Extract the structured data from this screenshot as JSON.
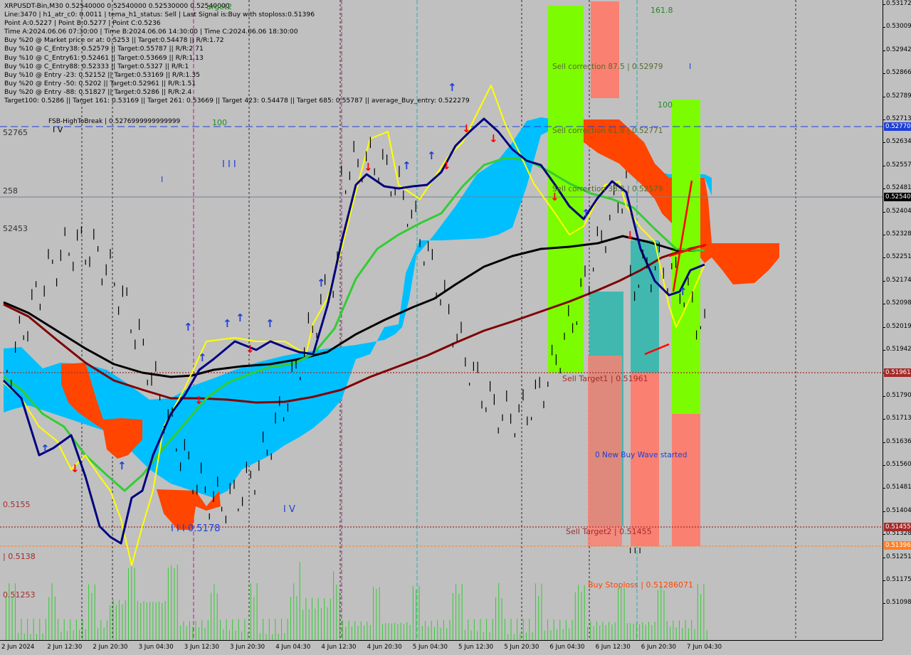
{
  "window": {
    "symbol_line": "XRPUSDT-Bin,M30  0.52540000 0.52540000 0.52530000 0.52540000"
  },
  "info_lines": [
    "Line:3470 | h1_atr_c0: 0.0011 | tema_h1_status: Sell | Last Signal is:Buy with stoploss:0.51396",
    "Point A:0.5227 | Point B:0.5277 | Point C:0.5236",
    "Time A:2024.06.06 07:30:00 | Time B:2024.06.06 14:30:00 | Time C:2024.06.06 18:30:00",
    "Buy %20 @ Market price or at: 0.5253 || Target:0.54478 || R/R:1.72",
    "Buy %10 @ C_Entry38: 0.52579 || Target:0.55787 || R/R:2.71",
    "Buy %10 @ C_Entry61: 0.52461 || Target:0.53669 || R/R:1.13",
    "Buy %10 @ C_Entry88: 0.52333 || Target:0.5327 || R/R:1",
    "Buy %10 @ Entry -23: 0.52152 || Target:0.53169 || R/R:1.35",
    "Buy %20 @ Entry -50: 0.5202 || Target:0.52961 || R/R:1.51",
    "Buy %20 @ Entry -88: 0.51827 || Target:0.5286 || R/R:2.4",
    "Target100: 0.5286 || Target 161: 0.53169 || Target 261: 0.53669 || Target 423: 0.54478 || Target 685: 0.55787 || average_Buy_entry: 0.522279"
  ],
  "chart_labels": {
    "target2": "arget2",
    "fsb": "FSB-HighToBreak | 0.5276999999999999",
    "fsb_100": "100",
    "level_52765": "52765",
    "level_258": "258",
    "level_52453": "52453",
    "level_5155": "0.5155",
    "level_5138": "| 0.5138",
    "level_51253": "0.51253",
    "iv_top": "I V",
    "iii": "I I I",
    "i_mark": "I",
    "iii_5178": "I I I 0.5178",
    "iv_bottom": "I V",
    "fib_161": "161.8",
    "fib_100": "100",
    "blue_bar": "I",
    "sell_corr_875": "Sell correction 87.5 | 0.52979",
    "sell_corr_618": "Sell correction 61.8 | 0.52771",
    "sell_corr_382": "Sell correction 38.2 | 0.52579",
    "sell_target1": "Sell Target1 | 0.51961",
    "sell_target2": "Sell Target2 | 0.51455",
    "new_buy_wave": "0 New Buy Wave started",
    "iii_bottom": "I I I",
    "buy_stoploss": "Buy Stoploss | 0.51286071",
    "ii_marker": "I I"
  },
  "price_axis": {
    "ticks": [
      "0.53172",
      "0.53009",
      "0.52942",
      "0.52866",
      "0.52789",
      "0.52713",
      "0.52634",
      "0.52557",
      "0.52481",
      "0.52404",
      "0.52328",
      "0.52251",
      "0.52174",
      "0.52098",
      "0.52019",
      "0.51942",
      "0.51866",
      "0.51790",
      "0.51713",
      "0.51636",
      "0.51560",
      "0.51481",
      "0.51404",
      "0.51328",
      "0.51251",
      "0.51175",
      "0.51098"
    ],
    "tags": [
      {
        "text": "0.52770",
        "bg": "#1e3fd8",
        "fg": "#ffffff"
      },
      {
        "text": "0.52540",
        "bg": "#000000",
        "fg": "#ffffff"
      },
      {
        "text": "0.51961",
        "bg": "#a52a2a",
        "fg": "#ffffff"
      },
      {
        "text": "0.51455",
        "bg": "#a52a2a",
        "fg": "#ffffff"
      },
      {
        "text": "0.51396",
        "bg": "#ff7f24",
        "fg": "#ffffff"
      }
    ]
  },
  "time_axis": {
    "ticks": [
      "2 Jun 2024",
      "2 Jun 12:30",
      "2 Jun 20:30",
      "3 Jun 04:30",
      "3 Jun 12:30",
      "3 Jun 20:30",
      "4 Jun 04:30",
      "4 Jun 12:30",
      "4 Jun 20:30",
      "5 Jun 04:30",
      "5 Jun 12:30",
      "5 Jun 20:30",
      "6 Jun 04:30",
      "6 Jun 12:30",
      "6 Jun 20:30",
      "7 Jun 04:30"
    ]
  },
  "colors": {
    "background": "#c0c0c0",
    "cloud_bull": "#00bfff",
    "cloud_bear": "#ff4500",
    "ma_fast": "#000080",
    "ma_yellow": "#ffff00",
    "ma_green": "#32cd32",
    "ma_black": "#000000",
    "ma_maroon": "#800000",
    "zone_green": "#7cfc00",
    "zone_salmon": "#fa8072",
    "zone_teal": "#40b8b0",
    "volume": "#32cd32"
  }
}
